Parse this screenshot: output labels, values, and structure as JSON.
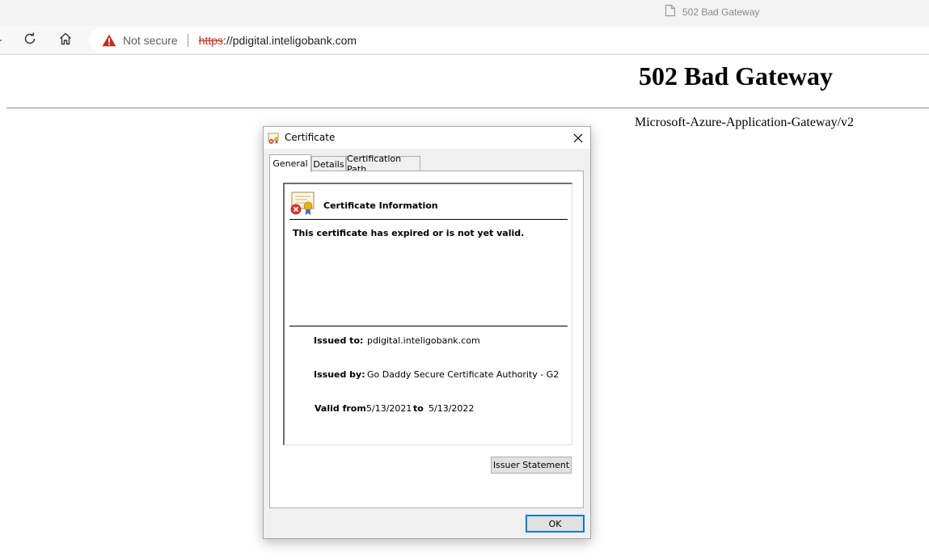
{
  "browser": {
    "tab": {
      "title": "502 Bad Gateway",
      "icon": "page-icon"
    },
    "toolbar": {
      "refresh_icon": "refresh-icon",
      "home_icon": "home-icon"
    },
    "address_bar": {
      "security_icon": "warning-icon",
      "security_label": "Not secure",
      "url_scheme": "https",
      "url_rest": "://pdigital.inteligobank.com",
      "warning_color": "#c42b1c"
    }
  },
  "page": {
    "heading": "502 Bad Gateway",
    "server": "Microsoft-Azure-Application-Gateway/v2"
  },
  "dialog": {
    "title": "Certificate",
    "tabs": [
      {
        "label": "General",
        "active": true
      },
      {
        "label": "Details",
        "active": false
      },
      {
        "label": "Certification Path",
        "active": false
      }
    ],
    "info": {
      "title": "Certificate Information",
      "message": "This certificate has expired or is not yet valid.",
      "issued_to_label": "Issued to:",
      "issued_to": "pdigital.inteligobank.com",
      "issued_by_label": "Issued by:",
      "issued_by": "Go Daddy Secure Certificate Authority - G2",
      "valid_from_label": "Valid from",
      "valid_from": "5/13/2021",
      "to_label": "to",
      "valid_to": "5/13/2022"
    },
    "issuer_statement_button": "Issuer Statement",
    "ok_button": "OK",
    "accent_color": "#0078d7"
  }
}
